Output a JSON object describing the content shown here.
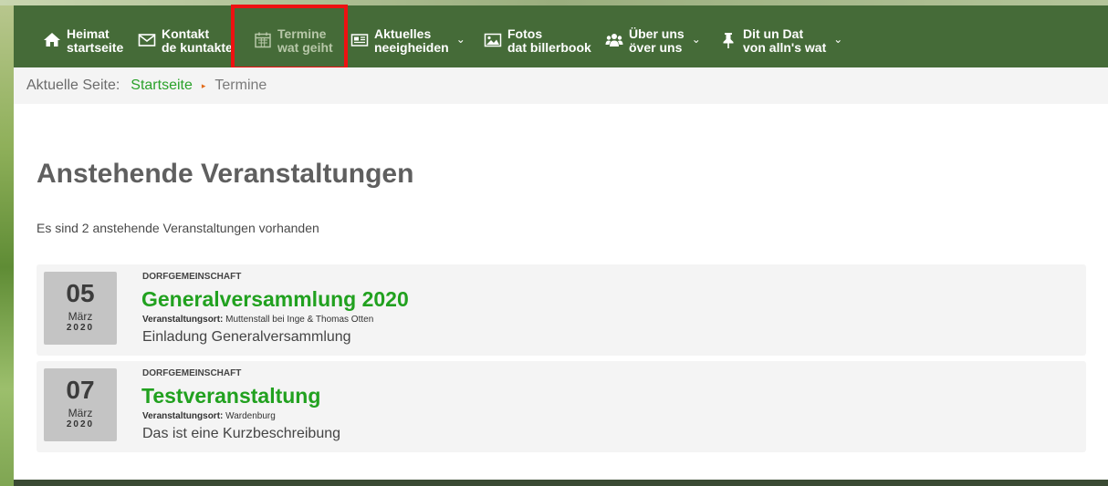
{
  "nav": {
    "items": [
      {
        "title": "Heimat",
        "sub": "startseite",
        "icon": "home-icon"
      },
      {
        "title": "Kontakt",
        "sub": "de kuntakte",
        "icon": "mail-icon"
      },
      {
        "title": "Termine",
        "sub": "wat geiht",
        "icon": "calendar-icon"
      },
      {
        "title": "Aktuelles",
        "sub": "neeigheiden",
        "icon": "newspaper-icon"
      },
      {
        "title": "Fotos",
        "sub": "dat billerbook",
        "icon": "image-icon"
      },
      {
        "title": "Über uns",
        "sub": "över uns",
        "icon": "users-icon"
      },
      {
        "title": "Dit un Dat",
        "sub": "von alln's wat",
        "icon": "pin-icon"
      }
    ],
    "caret": "⌄"
  },
  "breadcrumb": {
    "label": "Aktuelle Seite:",
    "home": "Startseite",
    "separator": "▸",
    "current": "Termine"
  },
  "main": {
    "title": "Anstehende Veranstaltungen",
    "count_text": "Es sind 2 anstehende Veranstaltungen vorhanden",
    "location_label": "Veranstaltungsort:",
    "events": [
      {
        "day": "05",
        "month": "März",
        "year": "2020",
        "category": "DORFGEMEINSCHAFT",
        "title": "Generalversammlung 2020",
        "location": "Muttenstall bei Inge & Thomas Otten",
        "description": "Einladung Generalversammlung"
      },
      {
        "day": "07",
        "month": "März",
        "year": "2020",
        "category": "DORFGEMEINSCHAFT",
        "title": "Testveranstaltung",
        "location": "Wardenburg",
        "description": "Das ist eine Kurzbeschreibung"
      }
    ]
  },
  "colors": {
    "nav_bg": "#456b38",
    "link_green": "#21a11f",
    "highlight": "#ee1111"
  }
}
